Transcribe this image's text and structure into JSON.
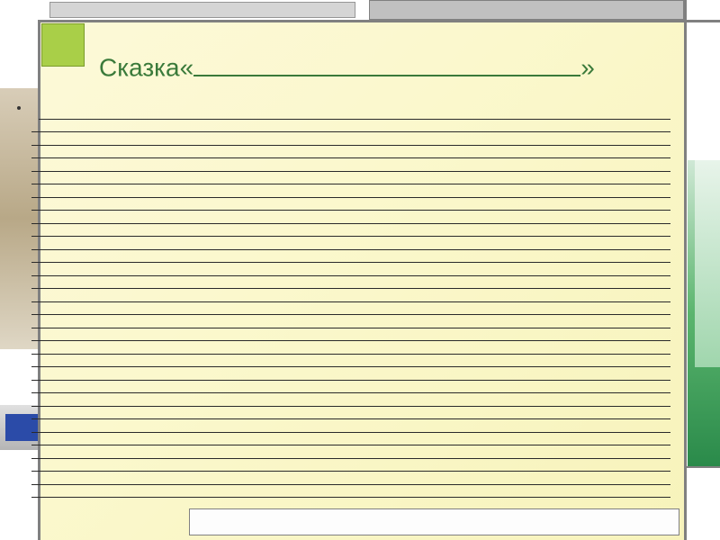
{
  "title": {
    "prefix": "Сказка«",
    "suffix": "»"
  },
  "body": {
    "line_count": 30
  }
}
